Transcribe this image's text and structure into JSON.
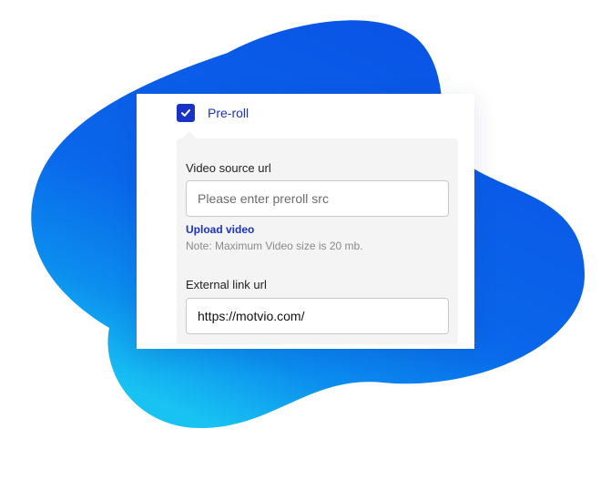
{
  "colors": {
    "accent": "#1a33c7",
    "blob_deep": "#0a55e6",
    "blob_light": "#18c3f2",
    "panel": "#f4f4f4"
  },
  "preroll": {
    "checked": true,
    "label": "Pre-roll",
    "check_icon": "check-icon"
  },
  "video_source": {
    "label": "Video source url",
    "placeholder": "Please enter preroll src",
    "value": ""
  },
  "upload": {
    "link_label": "Upload video",
    "note": "Note: Maximum Video size is 20 mb."
  },
  "external_link": {
    "label": "External link url",
    "value": "https://motvio.com/"
  }
}
